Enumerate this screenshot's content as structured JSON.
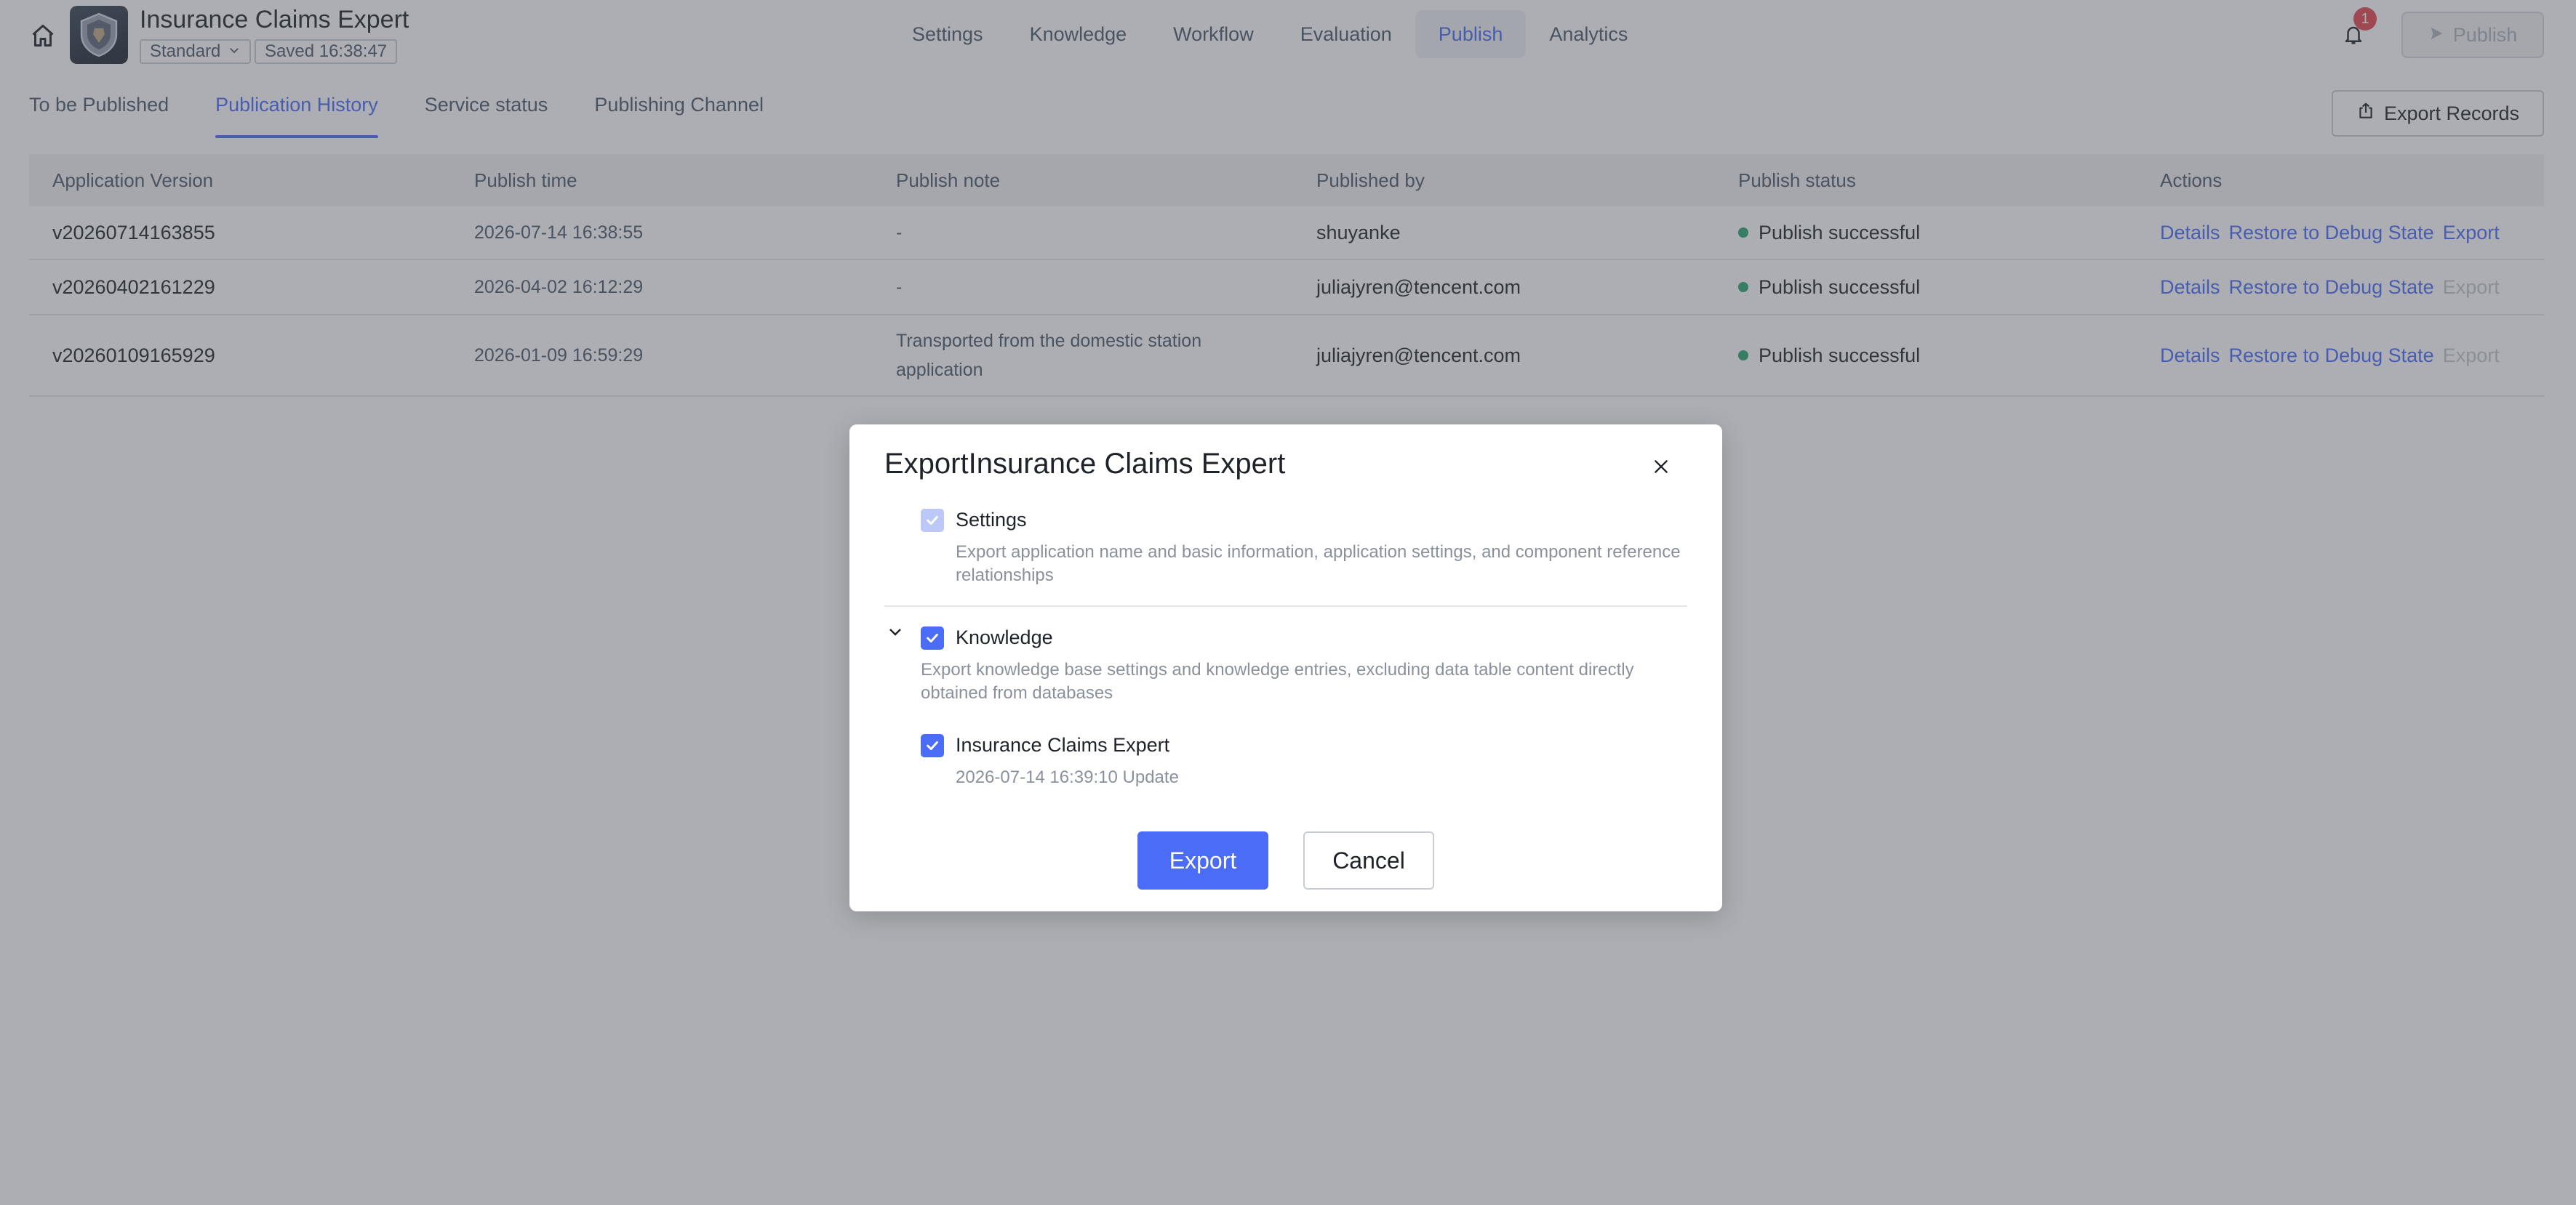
{
  "header": {
    "app_name": "Insurance Claims Expert",
    "mode": "Standard",
    "saved": "Saved 16:38:47",
    "nav": [
      "Settings",
      "Knowledge",
      "Workflow",
      "Evaluation",
      "Publish",
      "Analytics"
    ],
    "active_nav": "Publish",
    "notification_count": "1",
    "publish_label": "Publish"
  },
  "subtabs": {
    "items": [
      "To be Published",
      "Publication History",
      "Service status",
      "Publishing Channel"
    ],
    "active": "Publication History",
    "export_records_label": "Export Records"
  },
  "table": {
    "columns": [
      "Application Version",
      "Publish time",
      "Publish note",
      "Published by",
      "Publish status",
      "Actions"
    ],
    "rows": [
      {
        "version": "v20260714163855",
        "time": "2026-07-14 16:38:55",
        "note": "-",
        "by": "shuyanke",
        "status": "Publish successful",
        "action_details": "Details",
        "action_restore": "Restore to Debug State",
        "action_export": "Export"
      },
      {
        "version": "v20260402161229",
        "time": "2026-04-02 16:12:29",
        "note": "-",
        "by": "juliajyren@tencent.com",
        "status": "Publish successful",
        "action_details": "Details",
        "action_restore": "Restore to Debug State",
        "action_export": "Export"
      },
      {
        "version": "v20260109165929",
        "time": "2026-01-09 16:59:29",
        "note": "Transported from the domestic station application",
        "by": "juliajyren@tencent.com",
        "status": "Publish successful",
        "action_details": "Details",
        "action_restore": "Restore to Debug State",
        "action_export": "Export"
      }
    ]
  },
  "modal": {
    "title": "ExportInsurance Claims Expert",
    "settings_label": "Settings",
    "settings_desc": "Export application name and basic information, application settings, and component reference relationships",
    "knowledge_label": "Knowledge",
    "knowledge_desc": "Export knowledge base settings and knowledge entries, excluding data table content directly obtained from databases",
    "kb_item_label": "Insurance Claims Expert",
    "kb_item_meta": "2026-07-14 16:39:10 Update",
    "export_label": "Export",
    "cancel_label": "Cancel"
  },
  "colors": {
    "accent": "#4a6cf7",
    "success": "#2ba471",
    "badge": "#e5484d"
  }
}
